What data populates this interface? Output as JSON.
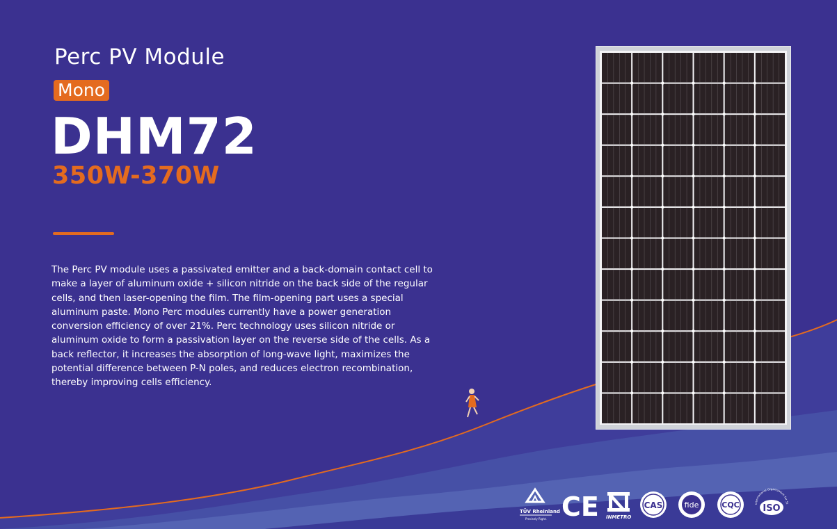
{
  "header": {
    "subtitle": "Perc PV Module",
    "tag": "Mono",
    "model": "DHM72",
    "power_range": "350W-370W"
  },
  "description": "The Perc PV module uses a passivated emitter and a back-domain contact cell to make a layer of aluminum oxide + silicon nitride on the back side of the regular cells, and then laser-opening the film. The film-opening part uses a special aluminum paste. Mono Perc modules currently have a power generation conversion efficiency of over 21%. Perc technology uses silicon nitride or aluminum oxide to form a passivation layer on the reverse side of the cells. As a back reflector, it increases the absorption of long-wave light, maximizes the potential difference between P-N poles, and reduces electron recombination, thereby improving cells efficiency.",
  "certifications": {
    "tuv_brand": "TÜV Rheinland",
    "tuv_tagline": "Precisely Right.",
    "ce": "CE",
    "inmetro": "INMETRO",
    "cas": "CAS",
    "fide": "fide",
    "cqc": "CQC",
    "iso": "ISO",
    "iso_ring": "International Organization for Standardization"
  },
  "colors": {
    "background": "#3b3190",
    "accent": "#e46b1f",
    "text": "#ffffff"
  }
}
